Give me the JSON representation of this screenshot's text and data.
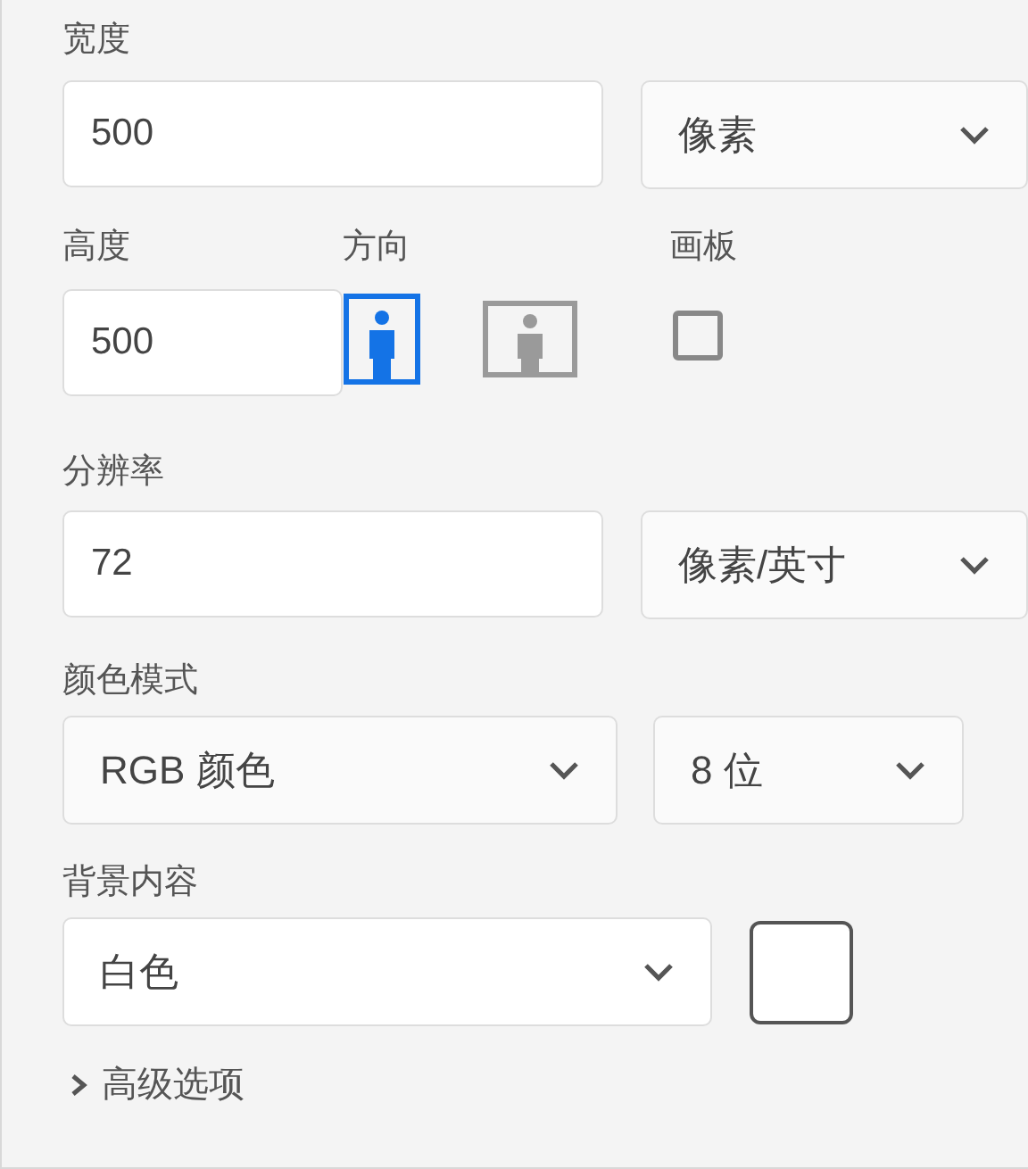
{
  "width": {
    "label": "宽度",
    "value": "500",
    "unit": "像素"
  },
  "height": {
    "label": "高度",
    "value": "500"
  },
  "orientation": {
    "label": "方向",
    "options": [
      {
        "kind": "portrait",
        "selected": true
      },
      {
        "kind": "landscape",
        "selected": false
      }
    ]
  },
  "artboard": {
    "label": "画板",
    "checked": false
  },
  "resolution": {
    "label": "分辨率",
    "value": "72",
    "unit": "像素/英寸"
  },
  "color_mode": {
    "label": "颜色模式",
    "mode": "RGB 颜色",
    "depth": "8 位"
  },
  "background": {
    "label": "背景内容",
    "value": "白色",
    "color": "#ffffff"
  },
  "advanced": {
    "label": "高级选项",
    "expanded": false
  }
}
